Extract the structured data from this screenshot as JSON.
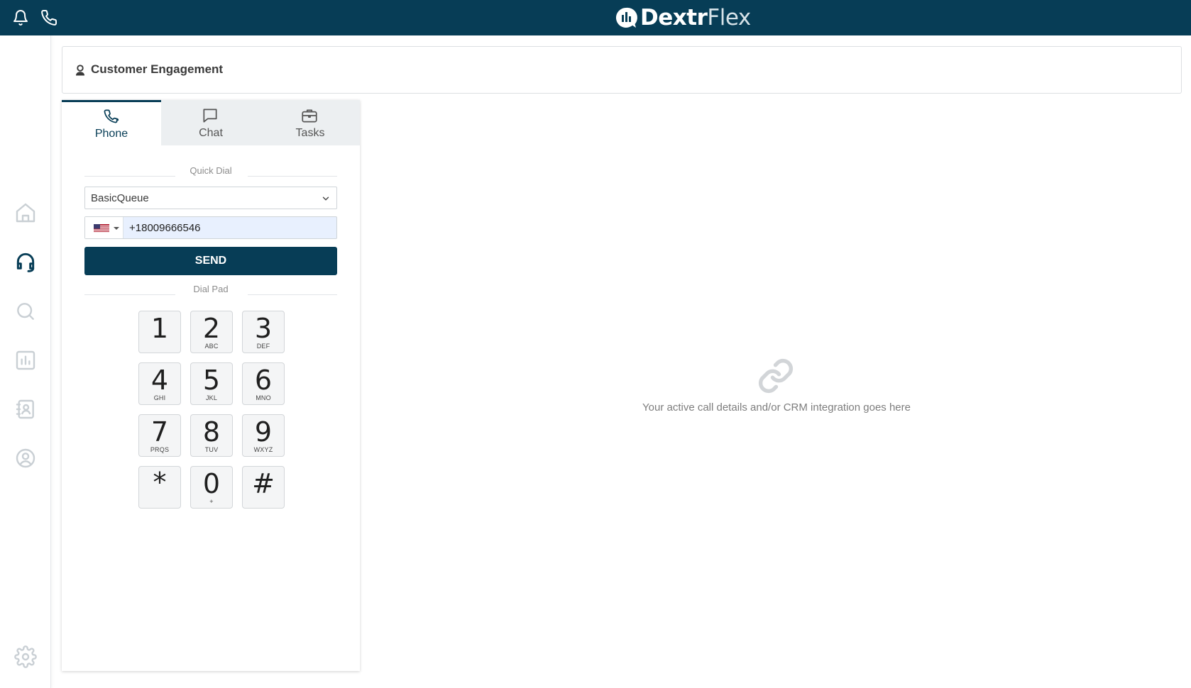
{
  "brand": {
    "part1": "Dextr",
    "part2": "Flex"
  },
  "header": {
    "title": "Customer Engagement"
  },
  "tabs": [
    {
      "label": "Phone",
      "icon": "phone-icon",
      "active": true
    },
    {
      "label": "Chat",
      "icon": "chat-icon",
      "active": false
    },
    {
      "label": "Tasks",
      "icon": "briefcase-icon",
      "active": false
    }
  ],
  "quick_dial": {
    "label": "Quick Dial",
    "queue_value": "BasicQueue",
    "country": "us-flag-icon",
    "phone_value": "+18009666546",
    "send_label": "SEND"
  },
  "dial_pad": {
    "label": "Dial Pad",
    "keys": [
      {
        "digit": "1",
        "letters": ""
      },
      {
        "digit": "2",
        "letters": "ABC"
      },
      {
        "digit": "3",
        "letters": "DEF"
      },
      {
        "digit": "4",
        "letters": "GHI"
      },
      {
        "digit": "5",
        "letters": "JKL"
      },
      {
        "digit": "6",
        "letters": "MNO"
      },
      {
        "digit": "7",
        "letters": "PRQS"
      },
      {
        "digit": "8",
        "letters": "TUV"
      },
      {
        "digit": "9",
        "letters": "WXYZ"
      },
      {
        "digit": "*",
        "letters": ""
      },
      {
        "digit": "0",
        "letters": "+"
      },
      {
        "digit": "#",
        "letters": ""
      }
    ]
  },
  "main": {
    "empty_message": "Your active call details and/or CRM integration goes here"
  },
  "colors": {
    "primary": "#073d56",
    "sidebar_icon": "#c9cfd4",
    "active_icon": "#073d56"
  }
}
